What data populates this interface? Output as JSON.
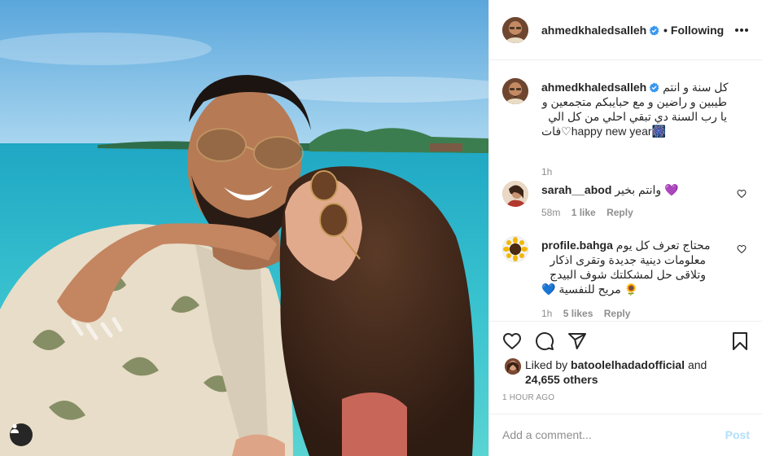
{
  "post": {
    "author": "ahmedkhaledsalleh",
    "follow_status": "Following",
    "follow_separator": "•"
  },
  "caption": {
    "username": "ahmedkhaledsalleh",
    "line1": "كل سنة و انتم",
    "line2": "طيبين و راضين و مع حبايبكم متجمعين و",
    "line3": "يا رب السنة دي تبقي احلي من كل الي",
    "line4_a": "فات",
    "line4_b": "happy new year",
    "age": "1h"
  },
  "comments": [
    {
      "username": "sarah__abod",
      "text": "وانتم بخير",
      "emoji": "💜",
      "age": "58m",
      "likes": "1 like",
      "reply": "Reply"
    },
    {
      "username": "profile.bahga",
      "line1": "محتاج تعرف كل يوم",
      "line2": "معلومات دينية جديدة وتقرى اذكار",
      "line3": "وتلاقى حل لمشكلتك شوف البيدج",
      "line4": "مريح للنفسية",
      "emoji1": "💙",
      "emoji2": "🌻",
      "age": "1h",
      "likes": "5 likes",
      "reply": "Reply"
    }
  ],
  "likes": {
    "prefix": "Liked by",
    "user": "batoolelhadadofficial",
    "and": "and",
    "others": "24,655 others"
  },
  "timestamp": "1 HOUR AGO",
  "add_comment": {
    "placeholder": "Add a comment...",
    "post_label": "Post"
  },
  "colors": {
    "verified": "#3897f0",
    "post_disabled": "#b2dffc",
    "purple_heart": "#8a4fd8",
    "blue_heart": "#1d6fd6"
  }
}
